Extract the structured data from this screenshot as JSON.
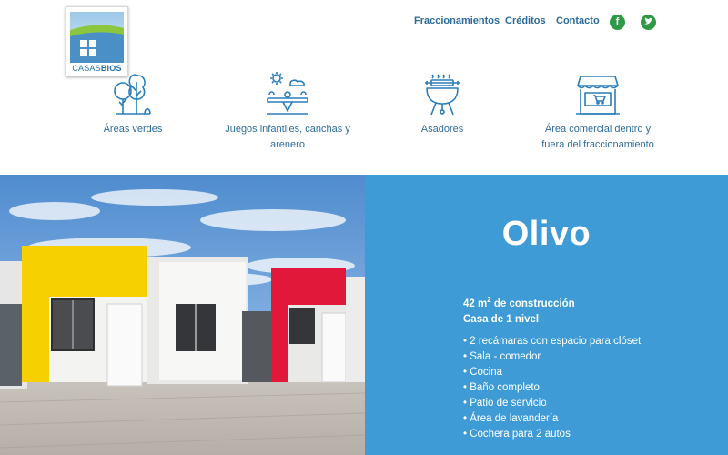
{
  "brand": {
    "logo_text_light": "CASAS",
    "logo_text_bold": "BIOS"
  },
  "nav": {
    "items": [
      "Fraccionamientos",
      "Créditos",
      "Contacto"
    ],
    "social": [
      {
        "name": "facebook-icon",
        "glyph": "f",
        "color": "#2e9b44"
      },
      {
        "name": "twitter-icon",
        "glyph": "t",
        "color": "#2e9b44"
      }
    ]
  },
  "amenities": [
    {
      "icon": "trees-icon",
      "lines": [
        "Áreas verdes"
      ]
    },
    {
      "icon": "playground-icon",
      "lines": [
        "Juegos infantiles, canchas y",
        "arenero"
      ]
    },
    {
      "icon": "grill-icon",
      "lines": [
        "Asadores"
      ]
    },
    {
      "icon": "storefront-icon",
      "lines": [
        "Área comercial dentro y",
        "fuera del fraccionamiento"
      ]
    }
  ],
  "model": {
    "name": "Olivo",
    "area_value": "42 m",
    "area_sup": "2",
    "area_suffix": " de construcción",
    "levels": "Casa de 1 nivel",
    "features": [
      "2 recámaras con espacio para clóset",
      "Sala - comedor",
      "Cocina",
      "Baño completo",
      "Patio de servicio",
      "Área de lavandería",
      "Cochera para 2 autos"
    ]
  },
  "colors": {
    "accent": "#3e9bd6",
    "text_blue": "#2f6c9c",
    "social_green": "#2e9b44"
  }
}
